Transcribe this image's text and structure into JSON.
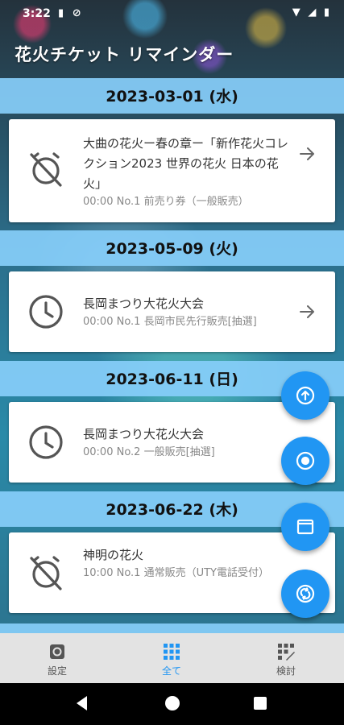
{
  "status_bar": {
    "time": "3:22",
    "left_icons": [
      "sim-card-icon",
      "do-not-disturb-icon"
    ],
    "right_icons": [
      "wifi-icon",
      "signal-icon",
      "battery-icon"
    ]
  },
  "app": {
    "title": "花火チケット リマインダー"
  },
  "groups": [
    {
      "date": "2023-03-01 (水)",
      "items": [
        {
          "icon": "alarm-off-icon",
          "title": "大曲の花火ー春の章ー「新作花火コレクション2023 世界の花火 日本の花火」",
          "subtitle": "00:00  No.1 前売り券（一般販売）"
        }
      ]
    },
    {
      "date": "2023-05-09 (火)",
      "items": [
        {
          "icon": "clock-icon",
          "title": "長岡まつり大花火大会",
          "subtitle": "00:00  No.1 長岡市民先行販売[抽選]"
        }
      ]
    },
    {
      "date": "2023-06-11 (日)",
      "items": [
        {
          "icon": "clock-icon",
          "title": "長岡まつり大花火大会",
          "subtitle": "00:00  No.2 一般販売[抽選]"
        }
      ]
    },
    {
      "date": "2023-06-22 (木)",
      "items": [
        {
          "icon": "alarm-off-icon",
          "title": "神明の花火",
          "subtitle": "10:00  No.1  通常販売（UTY電話受付）"
        }
      ]
    }
  ],
  "fabs": [
    "scroll-top-icon",
    "target-icon",
    "window-icon",
    "sync-icon"
  ],
  "bottom_nav": [
    {
      "label": "設定",
      "icon": "settings-icon",
      "active": false
    },
    {
      "label": "全て",
      "icon": "grid-icon",
      "active": true
    },
    {
      "label": "検討",
      "icon": "consider-grid-icon",
      "active": false
    }
  ],
  "colors": {
    "accent": "#2196f3",
    "date_header": "#87cefa",
    "bottom_nav_bg": "#e3e3e3"
  }
}
